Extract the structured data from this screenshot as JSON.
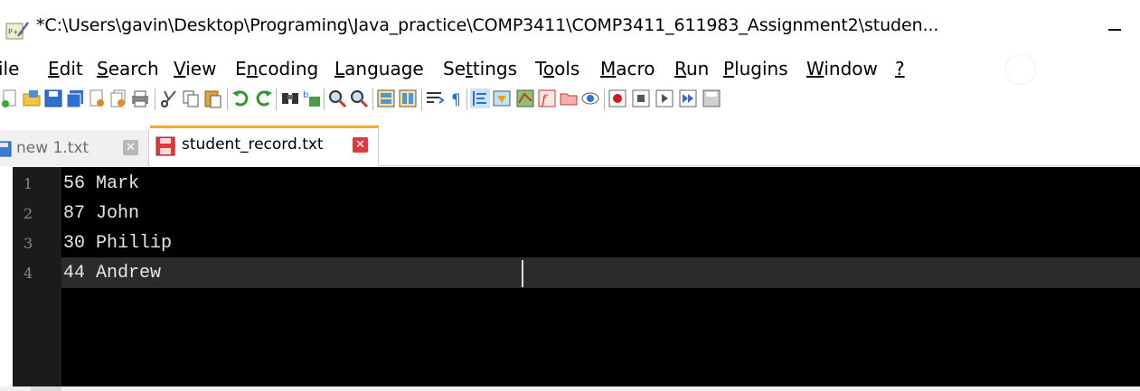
{
  "window": {
    "title": "*C:\\Users\\gavin\\Desktop\\Programing\\Java_practice\\COMP3411\\COMP3411_611983_Assignment2\\studen..."
  },
  "menu": {
    "items": [
      {
        "pre": "",
        "u": "",
        "post": "ile"
      },
      {
        "pre": "",
        "u": "E",
        "post": "dit"
      },
      {
        "pre": "",
        "u": "S",
        "post": "earch"
      },
      {
        "pre": "",
        "u": "V",
        "post": "iew"
      },
      {
        "pre": "E",
        "u": "n",
        "post": "coding"
      },
      {
        "pre": "",
        "u": "L",
        "post": "anguage"
      },
      {
        "pre": "Se",
        "u": "t",
        "post": "tings"
      },
      {
        "pre": "T",
        "u": "o",
        "post": "ols"
      },
      {
        "pre": "",
        "u": "M",
        "post": "acro"
      },
      {
        "pre": "",
        "u": "R",
        "post": "un"
      },
      {
        "pre": "",
        "u": "P",
        "post": "lugins"
      },
      {
        "pre": "",
        "u": "W",
        "post": "indow"
      },
      {
        "pre": "",
        "u": "?",
        "post": ""
      }
    ]
  },
  "tabs": [
    {
      "label": "new 1.txt",
      "active": false
    },
    {
      "label": "student_record.txt",
      "active": true
    }
  ],
  "editor": {
    "lines": [
      {
        "num": "1",
        "text": "56 Mark"
      },
      {
        "num": "2",
        "text": "87 John"
      },
      {
        "num": "3",
        "text": "30 Phillip"
      },
      {
        "num": "4",
        "text": "44 Andrew"
      }
    ],
    "active_line": "4"
  },
  "colors": {
    "editor_bg": "#000000",
    "active_tab_accent": "#f5a623",
    "tab_close_red": "#e0393e"
  },
  "toolbar": {
    "icons": [
      "new-file-icon",
      "open-file-icon",
      "save-icon",
      "save-all-icon",
      "close-icon",
      "close-all-icon",
      "print-icon",
      "cut-icon",
      "copy-icon",
      "paste-icon",
      "undo-icon",
      "redo-icon",
      "find-icon",
      "replace-icon",
      "zoom-in-icon",
      "zoom-out-icon",
      "sync-vertical-icon",
      "sync-horizontal-icon",
      "word-wrap-icon",
      "show-all-chars-icon",
      "indent-guide-icon",
      "udl-icon",
      "doc-map-icon",
      "function-list-icon",
      "folder-workspace-icon",
      "monitoring-icon",
      "record-macro-icon",
      "stop-record-icon",
      "play-macro-icon",
      "run-macro-multiple-icon",
      "save-macro-icon"
    ]
  }
}
